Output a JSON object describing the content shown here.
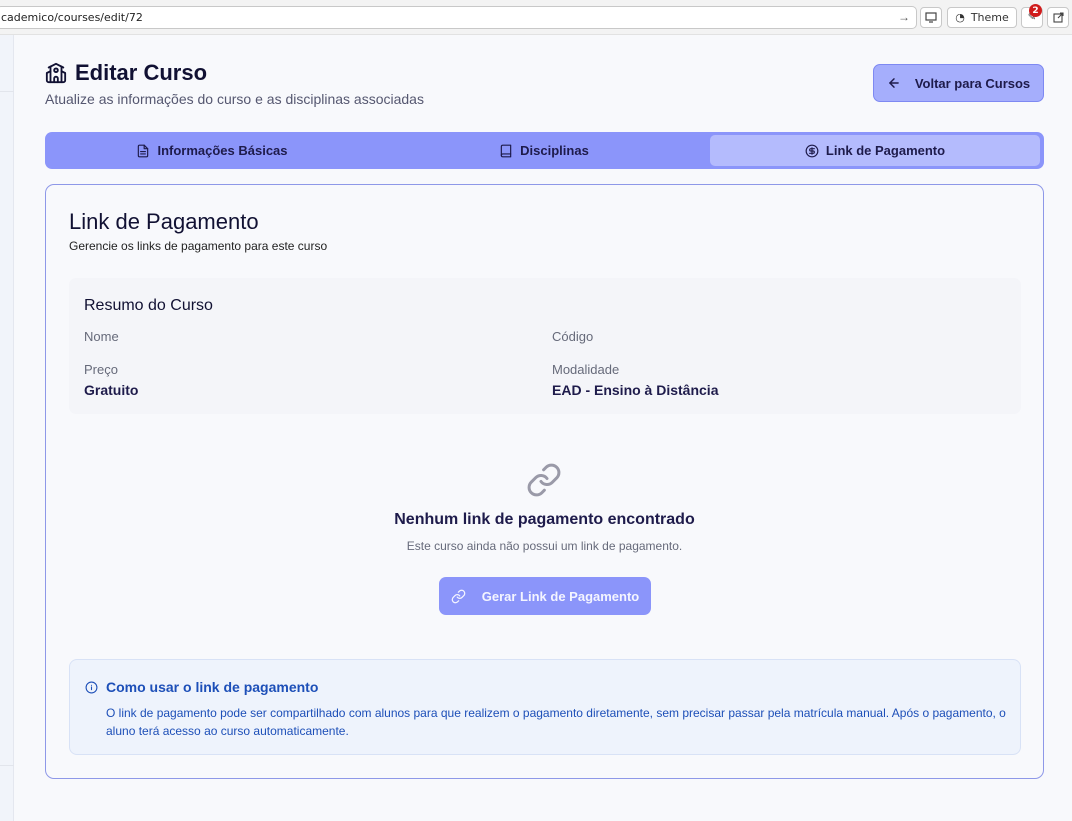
{
  "browser": {
    "url": "cademico/courses/edit/72",
    "theme_label": "Theme",
    "notification_count": "2"
  },
  "header": {
    "title": "Editar Curso",
    "subtitle": "Atualize as informações do curso e as disciplinas associadas",
    "back_label": "Voltar para Cursos"
  },
  "tabs": [
    {
      "label": "Informações Básicas",
      "icon": "document-icon",
      "active": false
    },
    {
      "label": "Disciplinas",
      "icon": "book-icon",
      "active": false
    },
    {
      "label": "Link de Pagamento",
      "icon": "dollar-circle-icon",
      "active": true
    }
  ],
  "card": {
    "title": "Link de Pagamento",
    "subtitle": "Gerencie os links de pagamento para este curso"
  },
  "summary": {
    "title": "Resumo do Curso",
    "name_label": "Nome",
    "name_value": "",
    "code_label": "Código",
    "code_value": "",
    "price_label": "Preço",
    "price_value": "Gratuito",
    "modality_label": "Modalidade",
    "modality_value": "EAD - Ensino à Distância"
  },
  "empty_state": {
    "icon": "link-icon",
    "title": "Nenhum link de pagamento encontrado",
    "subtitle": "Este curso ainda não possui um link de pagamento.",
    "button_label": "Gerar Link de Pagamento"
  },
  "info": {
    "icon": "info-icon",
    "title": "Como usar o link de pagamento",
    "text": "O link de pagamento pode ser compartilhado com alunos para que realizem o pagamento diretamente, sem precisar passar pela matrícula manual. Após o pagamento, o aluno terá acesso ao curso automaticamente."
  },
  "colors": {
    "accent": "#8b95fa",
    "accent_light": "#a5aefc",
    "info_text": "#1d4fb8",
    "background": "#f8f9fc"
  }
}
